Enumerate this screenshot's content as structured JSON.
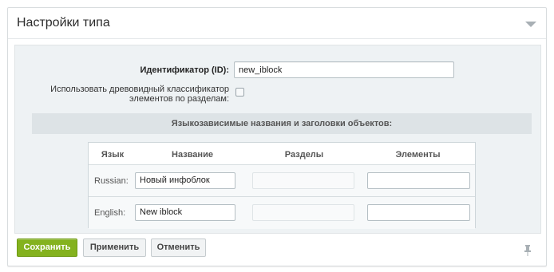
{
  "panel": {
    "title": "Настройки типа"
  },
  "form": {
    "id_label": "Идентификатор (ID):",
    "id_value": "new_iblock",
    "tree_label": "Использовать древовидный классификатор элементов по разделам:",
    "tree_checked": false
  },
  "section": {
    "title": "Языкозависимые названия и заголовки объектов:"
  },
  "lang_table": {
    "headers": [
      "Язык",
      "Название",
      "Разделы",
      "Элементы"
    ],
    "rows": [
      {
        "lang": "Russian:",
        "name": "Новый инфоблок",
        "sections": "",
        "elements": ""
      },
      {
        "lang": "English:",
        "name": "New iblock",
        "sections": "",
        "elements": ""
      }
    ]
  },
  "buttons": {
    "save": "Сохранить",
    "apply": "Применить",
    "cancel": "Отменить"
  },
  "colors": {
    "save_bg": "#84b21e",
    "content_bg": "#eef2f4",
    "section_bar_bg": "#dde3e6"
  },
  "icons": {
    "collapse": "chevron-down-icon",
    "pin": "pin-icon"
  }
}
